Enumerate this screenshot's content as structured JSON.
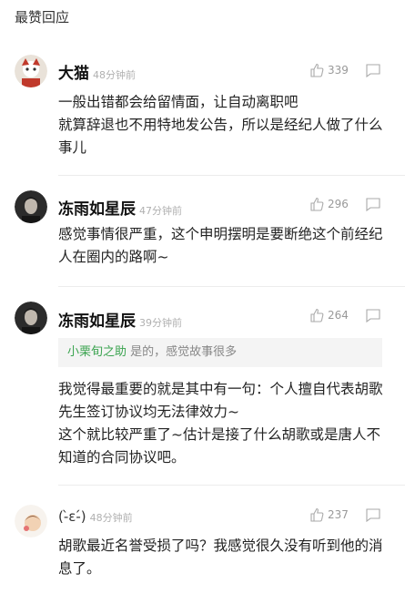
{
  "section": {
    "title": "最赞回应"
  },
  "comments": [
    {
      "author": "大猫",
      "time": "48分钟前",
      "likes": "339",
      "text": "一般出错都会给留情面，让自动离职吧\n就算辞退也不用特地发公告，所以是经纪人做了什么事儿"
    },
    {
      "author": "冻雨如星辰",
      "time": "47分钟前",
      "likes": "296",
      "text": "感觉事情很严重，这个申明摆明是要断绝这个前经纪人在圈内的路啊~"
    },
    {
      "author": "冻雨如星辰",
      "time": "39分钟前",
      "likes": "264",
      "quote_author": "小栗旬之助",
      "quote_text": "是的，感觉故事很多",
      "text": "我觉得最重要的就是其中有一句：个人擅自代表胡歌先生签订协议均无法律效力~\n这个就比较严重了~估计是接了什么胡歌或是唐人不知道的合同协议吧。"
    },
    {
      "author": "(-̀ε-́)",
      "time": "48分钟前",
      "likes": "237",
      "text": "胡歌最近名誉受损了吗？我感觉很久没有听到他的消息了。"
    }
  ],
  "icons": {
    "like": "thumbs-up-icon",
    "reply": "reply-bubble-icon"
  },
  "colors": {
    "quote_name": "#3aa34f",
    "meta": "#b0b0b0"
  }
}
